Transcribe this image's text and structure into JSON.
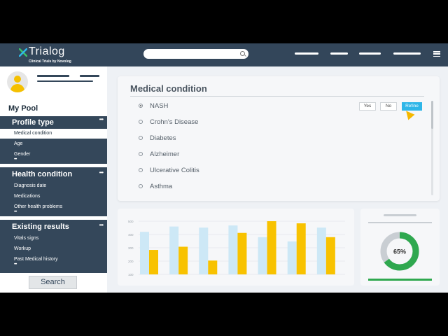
{
  "header": {
    "app_name": "Trialog",
    "tagline": "Clinical Trials by Novolog",
    "search_placeholder": ""
  },
  "sidebar": {
    "pool_title": "My Pool",
    "sections": [
      {
        "title": "Profile type",
        "items": [
          "Medical condition",
          "Age",
          "Gender"
        ],
        "active": "Medical condition"
      },
      {
        "title": "Health condition",
        "items": [
          "Diagnosis date",
          "Medications",
          "Other health problems"
        ]
      },
      {
        "title": "Existing results",
        "items": [
          "Vitals signs",
          "Workup",
          "Past Medical history"
        ]
      }
    ],
    "search_button": "Search"
  },
  "panel": {
    "title": "Medical condition",
    "options": [
      "NASH",
      "Crohn's Disease",
      "Diabetes",
      "Alzheimer",
      "Ulcerative Colitis",
      "Asthma"
    ],
    "selected": "NASH",
    "buttons": {
      "yes": "Yes",
      "no": "No",
      "refine": "Refine"
    }
  },
  "chart_data": {
    "type": "bar",
    "title": "",
    "xlabel": "",
    "ylabel": "",
    "y_ticks": [
      "500",
      "400",
      "300",
      "200",
      "100"
    ],
    "ylim": [
      0,
      500
    ],
    "categories": [
      "",
      "",
      "",
      "",
      "",
      "",
      ""
    ],
    "series": [
      {
        "values": [
          400,
          450,
          440,
          460,
          350,
          310,
          440
        ]
      },
      {
        "values": [
          230,
          260,
          130,
          390,
          550,
          480,
          350
        ]
      }
    ],
    "colors": [
      "#cde8f6",
      "#f8c200"
    ]
  },
  "donut": {
    "label": "65%",
    "value": 0.65,
    "color": "#2fa84f",
    "track": "#c9ced3"
  }
}
